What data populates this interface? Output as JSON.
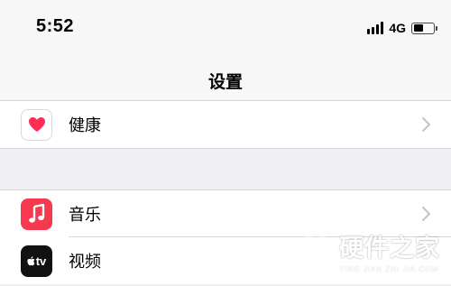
{
  "status_bar": {
    "time": "5:52",
    "network": "4G",
    "signal_icon": "cellular-signal-icon",
    "battery_icon": "battery-icon",
    "battery_level": 0.5
  },
  "nav": {
    "title": "设置"
  },
  "groups": [
    {
      "rows": [
        {
          "label": "健康",
          "icon": "health-heart-icon",
          "icon_color": "#ffffff",
          "accent": "#ff2d55"
        }
      ]
    },
    {
      "rows": [
        {
          "label": "音乐",
          "icon": "music-note-icon",
          "icon_color": "#f6394e"
        },
        {
          "label": "视频",
          "icon": "apple-tv-icon",
          "icon_color": "#111111",
          "icon_text": "tv"
        }
      ]
    }
  ],
  "watermark": {
    "title": "硬件之家",
    "subtitle": "YING JIAN ZHI JIA.COM"
  },
  "colors": {
    "background": "#efeff4",
    "bar": "#f7f7f7",
    "separator": "#d6d6da",
    "chevron": "#c4c4c7"
  }
}
